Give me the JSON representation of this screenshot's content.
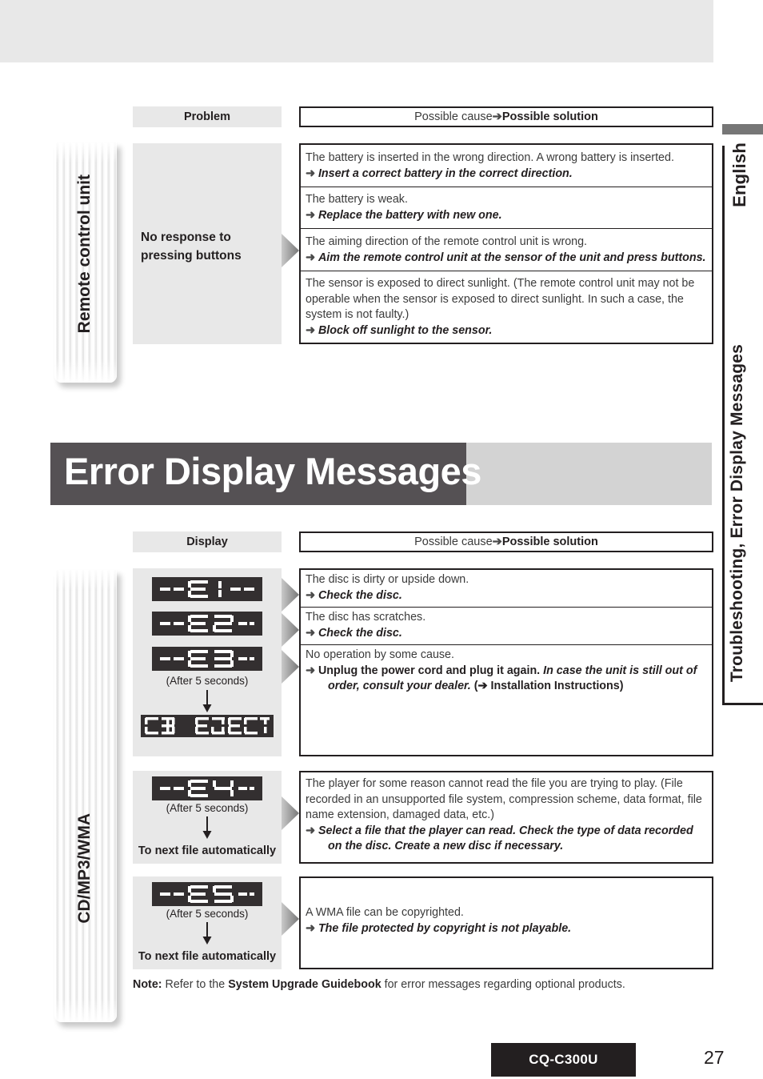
{
  "page": {
    "model": "CQ-C300U",
    "number": "27",
    "language_tab": "English",
    "section_tab": "Troubleshooting, Error Display Messages"
  },
  "troubleshooting": {
    "side_tab": "Remote control unit",
    "headers": {
      "left": "Problem",
      "right_cause": "Possible cause ",
      "right_arrow": "➔",
      "right_solution": " Possible solution"
    },
    "problem": "No response to\npressing buttons",
    "rows": [
      {
        "cause": "The battery is inserted in the wrong direction. A wrong battery is inserted.",
        "solution": "Insert a correct battery in the correct direction."
      },
      {
        "cause": "The battery is weak.",
        "solution": "Replace the battery with new one."
      },
      {
        "cause": "The aiming direction of the remote control unit is wrong.",
        "solution": "Aim the remote control unit at the sensor of the unit and press buttons."
      },
      {
        "cause": "The sensor is exposed to direct sunlight. (The remote control unit may not be operable when the sensor is exposed to direct sunlight. In such a case, the system is not faulty.)",
        "solution": "Block off sunlight to the sensor."
      }
    ]
  },
  "error_messages": {
    "banner_title": "Error Display Messages",
    "side_tab": "CD/MP3/WMA",
    "headers": {
      "left": "Display",
      "right_cause": "Possible cause ",
      "right_arrow": "➔",
      "right_solution": " Possible solution"
    },
    "group1": {
      "displays": [
        "--E1--",
        "--E2--",
        "--E3--"
      ],
      "after_caption": "(After 5 seconds)",
      "eject_display": "CD EJECT",
      "rows": [
        {
          "cause": "The disc is dirty or upside down.",
          "solution": "Check the disc."
        },
        {
          "cause": "The disc has scratches.",
          "solution": "Check the disc."
        },
        {
          "cause": "No operation by some cause.",
          "solution_upright": "Unplug the power cord and plug it again. ",
          "solution_italic": "In case the unit is still out of order, consult your dealer.",
          "solution_ref": " (➔ Installation Instructions)"
        }
      ]
    },
    "group2": {
      "display": "--E4--",
      "after_caption": "(After 5 seconds)",
      "next_file": "To next file automatically",
      "cause": "The player for some reason cannot read the file you are trying to play. (File recorded in an unsupported file system, compression scheme, data format, file name extension, damaged data, etc.)",
      "solution": "Select a file that the player can read. Check the type of data recorded on the disc. Create a new disc if necessary."
    },
    "group3": {
      "display": "--E5--",
      "after_caption": "(After 5 seconds)",
      "next_file": "To next file automatically",
      "cause": "A WMA file can be copyrighted.",
      "solution": "The file protected by copyright is not playable."
    },
    "note_label": "Note:",
    "note_text_1": " Refer to the ",
    "note_bold": "System Upgrade Guidebook",
    "note_text_2": " for error messages regarding optional products."
  },
  "colors": {
    "banner_dark": "#555154",
    "banner_light": "#d3d3d3",
    "gray_panel": "#e8e8e8",
    "lcd_bg": "#332f30",
    "ink": "#231f20"
  }
}
